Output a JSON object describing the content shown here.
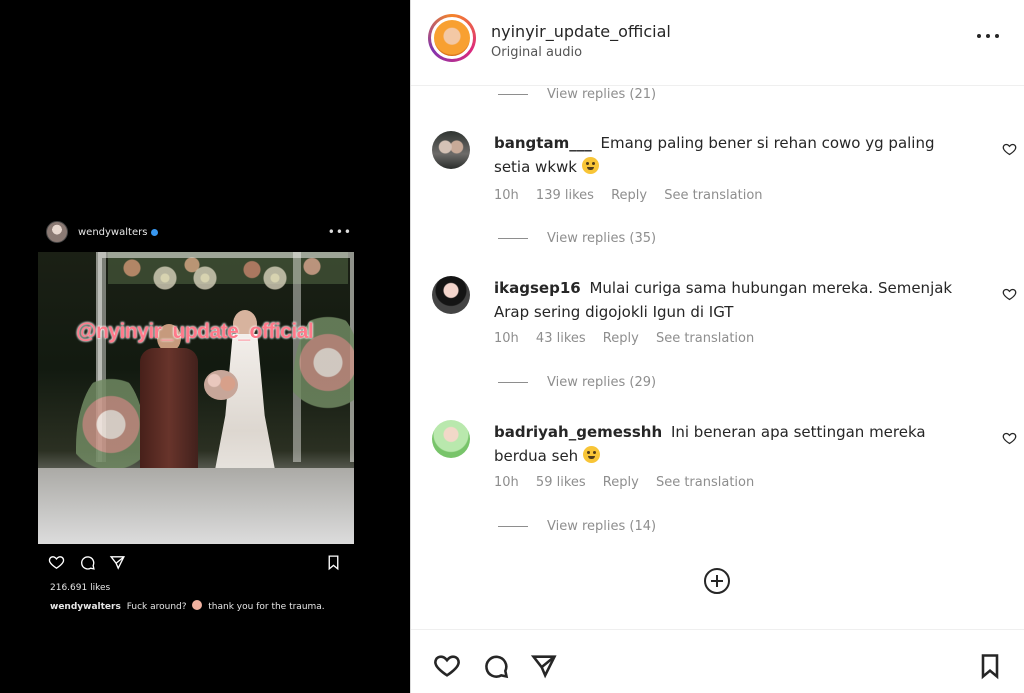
{
  "embedded_post": {
    "username": "wendywalters",
    "watermark_text": "@nyinyir_update_official",
    "likes": "216.691 likes",
    "caption_user": "wendywalters",
    "caption_text": "Fuck around?",
    "caption_text_after": "thank you for the trauma."
  },
  "header": {
    "author_name": "nyinyir_update_official",
    "audio_label": "Original audio"
  },
  "comments": [
    {
      "reply_count_above": "View replies (21)",
      "username": "bangtam___",
      "text": "Emang paling bener si rehan cowo yg paling setia wkwk",
      "time": "10h",
      "likes": "139 likes",
      "reply_label": "Reply",
      "translation_label": "See translation",
      "view_replies": "View replies (35)"
    },
    {
      "username": "ikagsep16",
      "text": "Mulai curiga sama hubungan mereka. Semenjak Arap sering digojokli Igun di IGT",
      "time": "10h",
      "likes": "43 likes",
      "reply_label": "Reply",
      "translation_label": "See translation",
      "view_replies": "View replies (29)"
    },
    {
      "username": "badriyah_gemesshh",
      "text": "Ini beneran apa settingan mereka berdua seh",
      "time": "10h",
      "likes": "59 likes",
      "reply_label": "Reply",
      "translation_label": "See translation",
      "view_replies": "View replies (14)"
    }
  ],
  "icons": {
    "more": "more-horizontal-icon",
    "like": "heart-icon",
    "comment": "comment-icon",
    "share": "send-icon",
    "save": "bookmark-icon",
    "add_comments": "plus-circle-icon"
  },
  "colors": {
    "media_background": "#000000",
    "panel_background": "#ffffff",
    "primary_text": "#262626",
    "secondary_text": "#8e8e8e",
    "watermark": "#ff7a8a"
  }
}
